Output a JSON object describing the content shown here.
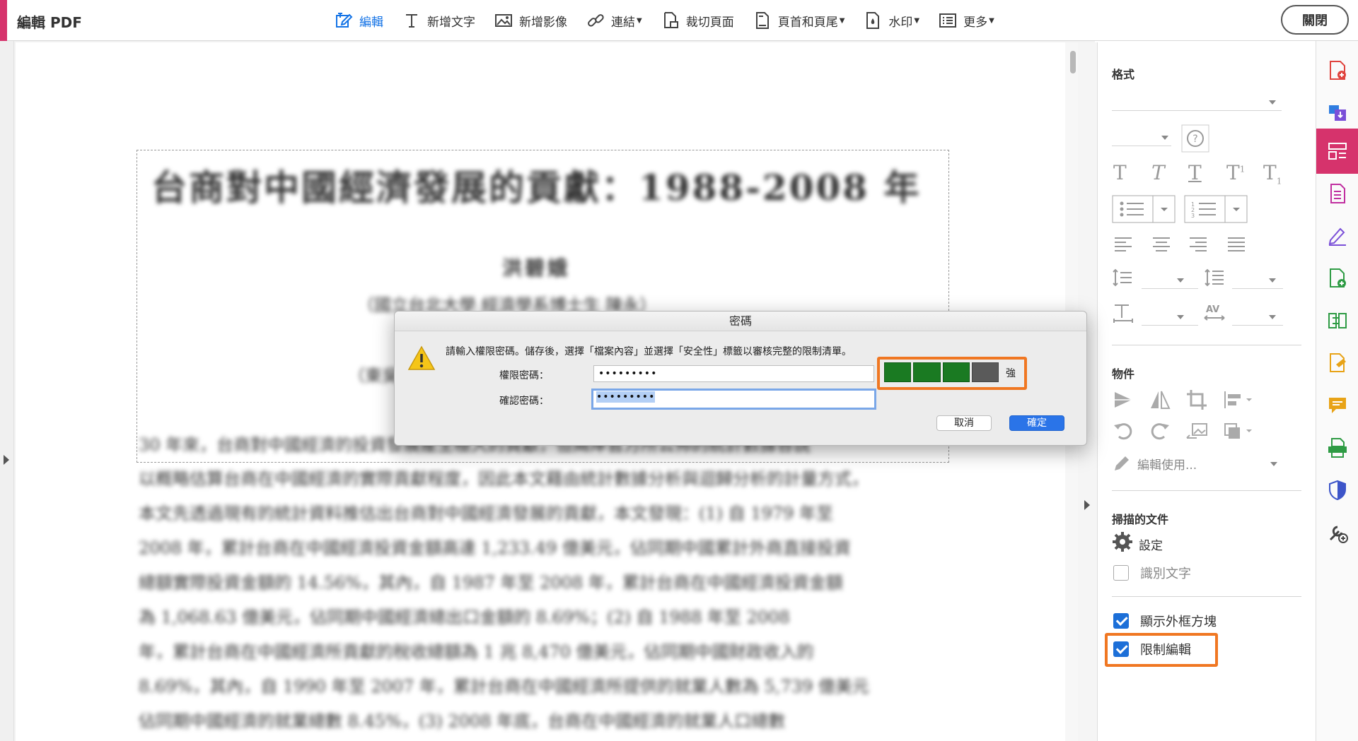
{
  "app": {
    "title": "編輯 PDF",
    "open_button": "關閉"
  },
  "toolbar": {
    "items": [
      {
        "label": "編輯",
        "icon": "edit-icon",
        "active": true,
        "dropdown": false
      },
      {
        "label": "新增文字",
        "icon": "text-icon",
        "active": false,
        "dropdown": false
      },
      {
        "label": "新增影像",
        "icon": "image-icon",
        "active": false,
        "dropdown": false
      },
      {
        "label": "連結",
        "icon": "link-icon",
        "active": false,
        "dropdown": true
      },
      {
        "label": "裁切頁面",
        "icon": "crop-page-icon",
        "active": false,
        "dropdown": false
      },
      {
        "label": "頁首和頁尾",
        "icon": "header-footer-icon",
        "active": false,
        "dropdown": true
      },
      {
        "label": "水印",
        "icon": "watermark-icon",
        "active": false,
        "dropdown": true
      },
      {
        "label": "更多",
        "icon": "more-icon",
        "active": false,
        "dropdown": true
      }
    ]
  },
  "document": {
    "title": "台商對中國經濟發展的貢獻：1988-2008 年",
    "author": "洪碧娥",
    "affiliation": "（國立台北大學 經濟學系博士生 陳永）",
    "affiliation2": "（東吳大學經濟學系副教授）",
    "lines": [
      "30 年來，台商對中國經濟的投資發展產生極大的貢獻，但兩岸官方所公佈的統計數據各說",
      "以概略估算台商在中國經濟的實際貢獻程度，因此本文藉由統計數據分析與迴歸分析的計量方式，",
      "本文先透過現有的統計資料推估出台商對中國經濟發展的貢獻，本文發現：(1) 自 1979 年至",
      "2008 年，累計台商在中國經濟投資金額高達 1,233.49 億美元，佔同期中國累計外商直接投資",
      "總額實際投資金額的 14.56%，其內，自 1987 年至 2008 年，累計台商在中國經濟投資金額",
      "為 1,068.63 億美元，佔同期中國經濟總出口金額的 8.69%；(2) 自 1988 年至 2008",
      "年，累計台商在中國經濟所貢獻的稅收總額為 1 兆 8,470 億美元，佔同期中國財政收入的",
      "8.69%，其內，自 1990 年至 2007 年，累計台商在中國經濟所提供的就業人數為 5,739 億美元",
      "佔同期中國經濟的就業總數 8.45%，(3) 2008 年底，台商在中國經濟的就業人口總數"
    ]
  },
  "dialog": {
    "title": "密碼",
    "message": "請輸入權限密碼。儲存後，選擇「檔案內容」並選擇「安全性」標籤以審核完整的限制清單。",
    "permission_label": "權限密碼：",
    "permission_value": "•••••••••",
    "confirm_label": "確認密碼：",
    "confirm_value": "•••••••••",
    "strength_label": "強",
    "strength_level": 0.75,
    "cancel_label": "取消",
    "ok_label": "確定",
    "strength_color": "#1a7a22"
  },
  "right_panel": {
    "format_section": "格式",
    "objects_section": "物件",
    "edit_using_label": "編輯使用...",
    "scanned_section": "掃描的文件",
    "settings_label": "設定",
    "recognize_text_label": "識別文字",
    "recognize_text_checked": false,
    "show_bbox_label": "顯示外框方塊",
    "show_bbox_checked": true,
    "restrict_editing_label": "限制編輯",
    "restrict_editing_checked": true
  },
  "highlight_color": "#f07722",
  "accent_color": "#d6336c",
  "side_icons": [
    "create-pdf-icon",
    "export-pdf-icon",
    "edit-pdf-icon",
    "organize-pages-icon",
    "fill-sign-icon",
    "combine-files-icon",
    "compress-icon",
    "request-signature-icon",
    "comment-icon",
    "scan-icon",
    "protect-icon",
    "more-tools-icon"
  ]
}
